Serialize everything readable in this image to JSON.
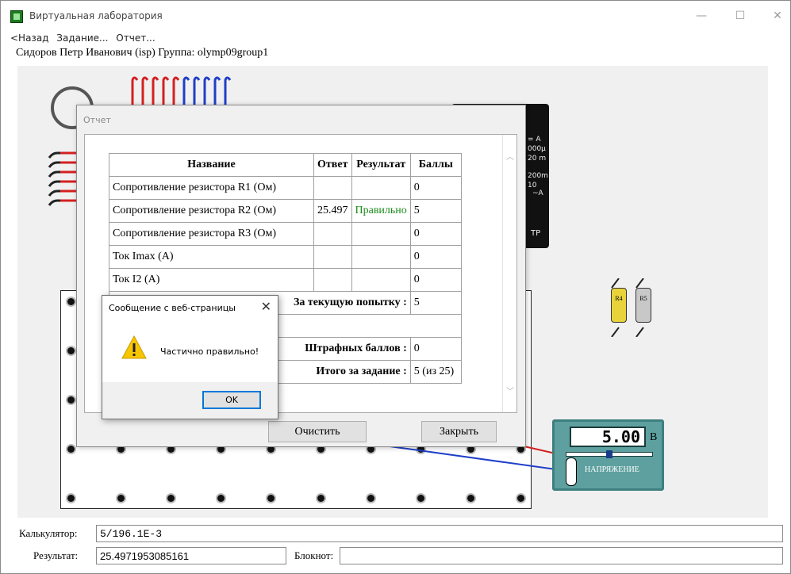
{
  "window": {
    "title": "Виртуальная лаборатория",
    "minimize": "—",
    "maximize": "☐",
    "close": "✕"
  },
  "menu": {
    "back": "<Назад",
    "task": "Задание...",
    "report": "Отчет..."
  },
  "user_line": "Сидоров Петр Иванович (isp)  Группа: olymp09group1",
  "lab": {
    "voltmeter": {
      "value": "5.00",
      "unit": "В",
      "label": "НАПРЯЖЕНИЕ"
    },
    "multimeter": {
      "scale_1": "= A",
      "scale_2": "000µ",
      "scale_3": "20 m",
      "scale_4": "200m",
      "scale_5": "10",
      "scale_6": "~A",
      "footer": "ТР"
    },
    "resistors": [
      {
        "label": "R4",
        "color": "#e8d33a"
      },
      {
        "label": "R5",
        "color": "#c8c8c8"
      }
    ]
  },
  "report": {
    "title": "Отчет",
    "headers": [
      "Название",
      "Ответ",
      "Результат",
      "Баллы"
    ],
    "rows": [
      {
        "name": "Сопротивление резистора R1 (Ом)",
        "answer": "",
        "result": "",
        "score": "0"
      },
      {
        "name": "Сопротивление резистора R2 (Ом)",
        "answer": "25.497",
        "result": "Правильно",
        "score": "5"
      },
      {
        "name": "Сопротивление резистора R3 (Ом)",
        "answer": "",
        "result": "",
        "score": "0"
      },
      {
        "name": "Ток Imax (A)",
        "answer": "",
        "result": "",
        "score": "0"
      },
      {
        "name": "Ток I2 (A)",
        "answer": "",
        "result": "",
        "score": "0"
      }
    ],
    "summary": {
      "current_attempt_label": "За текущую попытку :",
      "current_attempt_value": "5",
      "penalty_label": "Штрафных баллов :",
      "penalty_value": "0",
      "total_label": "Итого за задание :",
      "total_value": "5 (из 25)"
    },
    "clear_button": "Очистить",
    "close_button": "Закрыть"
  },
  "alert": {
    "title": "Сообщение с веб-страницы",
    "close": "✕",
    "message": "Частично правильно!",
    "ok": "OK"
  },
  "bottom": {
    "calculator_label": "Калькулятор:",
    "calculator_value": "5/196.1E-3",
    "result_label": "Результат:",
    "result_value": "25.4971953085161",
    "notepad_label": "Блокнот:",
    "notepad_value": ""
  },
  "colors": {
    "correct": "#1a8c1a",
    "voltmeter_body": "#5ea0a0",
    "wire_red": "#d42020",
    "wire_blue": "#1f3fc8"
  }
}
